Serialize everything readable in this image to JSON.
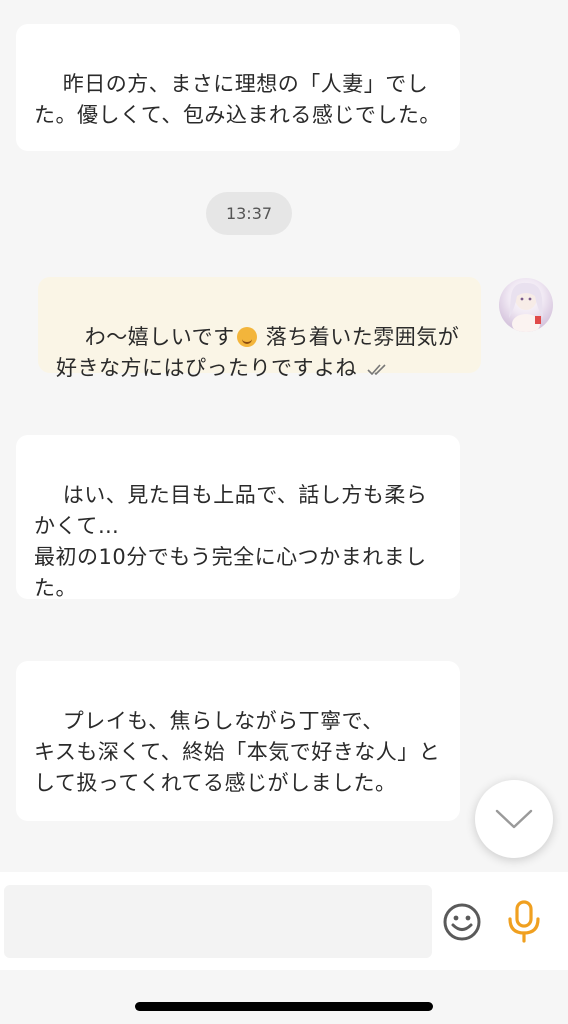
{
  "messages": [
    {
      "id": "msg1",
      "direction": "incoming",
      "text": "昨日の方、まさに理想の「人妻」でした。優しくて、包み込まれる感じでした。"
    },
    {
      "id": "msg3",
      "direction": "outgoing",
      "text_before_emoji": "わ〜嬉しいです",
      "emoji": "relieved-face-emoji",
      "text_after_emoji": " 落ち着いた雰囲気が好きな方にはぴったりですよね",
      "status_icon": "double-check-icon"
    },
    {
      "id": "msg4",
      "direction": "incoming",
      "text": "はい、見た目も上品で、話し方も柔らかくて…\n最初の10分でもう完全に心つかまれました。"
    },
    {
      "id": "msg5",
      "direction": "incoming",
      "text": "プレイも、焦らしながら丁寧で、\nキスも深くて、終始「本気で好きな人」として扱ってくれてる感じがしました。"
    }
  ],
  "timestamp": "13:37",
  "composer": {
    "placeholder": "",
    "value": "",
    "emoji_icon": "smiley-icon",
    "mic_icon": "microphone-icon"
  },
  "scroll_button_icon": "chevron-down-icon",
  "colors": {
    "background": "#f6f6f6",
    "incoming_bubble": "#ffffff",
    "outgoing_bubble": "#faf5e6",
    "accent_mic": "#f0a020",
    "timestamp_pill": "#e6e6e6"
  }
}
